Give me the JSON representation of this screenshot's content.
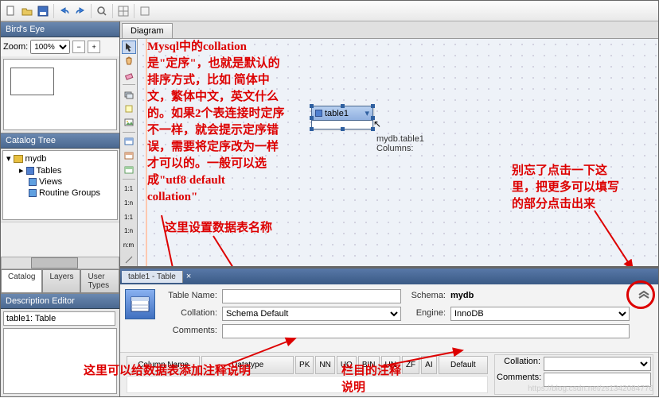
{
  "toolbar": {
    "icons": [
      "new",
      "open",
      "save",
      "sep",
      "undo",
      "redo",
      "sep",
      "find",
      "sep",
      "grid",
      "sep",
      "cfg"
    ]
  },
  "birds_eye": {
    "title": "Bird's Eye",
    "zoom_label": "Zoom:",
    "zoom_value": "100%"
  },
  "catalog": {
    "title": "Catalog Tree",
    "db": "mydb",
    "items": [
      "Tables",
      "Views",
      "Routine Groups"
    ]
  },
  "side_tabs": [
    "Catalog",
    "Layers",
    "User Types"
  ],
  "desc_editor": {
    "title": "Description Editor",
    "value": "table1: Table"
  },
  "diagram_tab": "Diagram",
  "table_object": {
    "name": "table1",
    "tooltip_name": "mydb.table1",
    "tooltip_cols": "Columns:"
  },
  "annotations": {
    "collation_note": "Mysql中的collation\n是\"定序\"，也就是默认的\n排序方式，比如 简体中\n文，繁体中文，英文什么\n的。如果2个表连接时定序\n不一样，就会提示定序错\n误，需要将定序改为一样\n才可以的。一般可以选\n成\"utf8 default\ncollation\"",
    "name_note": "这里设置数据表名称",
    "comment_note": "这里可以给数据表添加注释说明",
    "col_comment_note": "栏目的注释\n说明",
    "expand_note": "别忘了点击一下这\n里，把更多可以填写\n的部分点击出来"
  },
  "editor": {
    "tab": "table1 - Table",
    "table_name_label": "Table Name:",
    "table_name_value": "",
    "schema_label": "Schema:",
    "schema_value": "mydb",
    "collation_label": "Collation:",
    "collation_value": "Schema Default",
    "engine_label": "Engine:",
    "engine_value": "InnoDB",
    "comments_label": "Comments:",
    "columns": {
      "headers": [
        "Column Name",
        "Datatype",
        "PK",
        "NN",
        "UQ",
        "BIN",
        "UN",
        "ZF",
        "AI",
        "Default"
      ],
      "side_collation": "Collation:",
      "side_comments": "Comments:"
    }
  },
  "watermark": "https://blog.csdn.net/zs1342084776"
}
